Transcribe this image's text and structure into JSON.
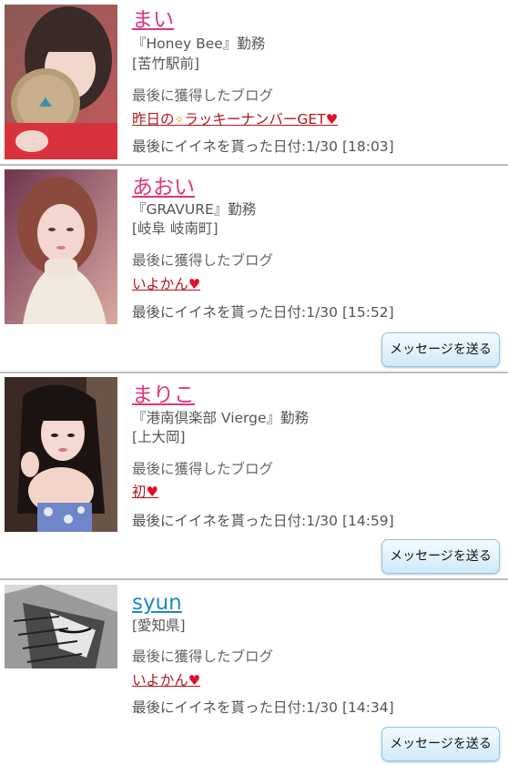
{
  "cards": [
    {
      "name": "まい",
      "shop": "『Honey Bee』勤務",
      "area": "[苦竹駅前]",
      "blog_label": "最後に獲得したブログ",
      "blog_title_a": "昨日の",
      "blog_title_b": "ラッキーナンバーGET",
      "date": "最後にイイネを貰った日付:1/30 [18:03]",
      "photo_icon": "woman-holding-coaster-photo"
    },
    {
      "name": "あおい",
      "shop": "『GRAVURE』勤務",
      "area": "[岐阜 岐南町]",
      "blog_label": "最後に獲得したブログ",
      "blog_title": "いよかん",
      "date": "最後にイイネを貰った日付:1/30 [15:52]",
      "button": "メッセージを送る",
      "photo_icon": "woman-turtleneck-photo"
    },
    {
      "name": "まりこ",
      "shop": "『港南倶楽部 Vierge』勤務",
      "area": "[上大岡]",
      "blog_label": "最後に獲得したブログ",
      "blog_title": "初",
      "date": "最後にイイネを貰った日付:1/30 [14:59]",
      "button": "メッセージを送る",
      "photo_icon": "woman-long-hair-photo"
    },
    {
      "name": "syun",
      "area": "[愛知県]",
      "blog_label": "最後に獲得したブログ",
      "blog_title": "いよかん",
      "date": "最後にイイネを貰った日付:1/30 [14:34]",
      "button": "メッセージを送る",
      "photo_icon": "manga-sketch-photo"
    }
  ],
  "colors": {
    "female_name": "#e0357a",
    "male_name": "#1e88c8",
    "blog_link": "#b4141e",
    "heart": "#e0102a",
    "button_border": "#8fc6e8"
  }
}
